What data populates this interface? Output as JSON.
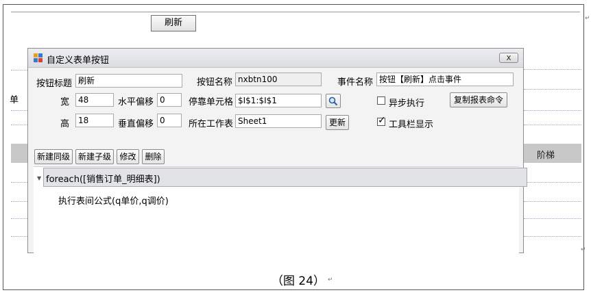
{
  "background": {
    "refresh_button_label": "刷新",
    "left_fragment": "单",
    "grid_header_label": "阶梯"
  },
  "dialog": {
    "title": "自定义表单按钮",
    "close_label": "x",
    "fields": {
      "button_title_label": "按钮标题",
      "button_title_value": "刷新",
      "button_name_label": "按钮名称",
      "button_name_value": "nxbtn100",
      "event_name_label": "事件名称",
      "event_name_value": "按钮【刷新】点击事件",
      "width_label": "宽",
      "width_value": "48",
      "h_offset_label": "水平偏移",
      "h_offset_value": "0",
      "dock_cell_label": "停靠单元格",
      "dock_cell_value": "$I$1:$I$1",
      "height_label": "高",
      "height_value": "18",
      "v_offset_label": "垂直偏移",
      "v_offset_value": "0",
      "sheet_label": "所在工作表",
      "sheet_value": "Sheet1"
    },
    "buttons": {
      "update": "更新",
      "copy_command": "复制报表命令",
      "new_sibling": "新建同级",
      "new_child": "新建子级",
      "modify": "修改",
      "delete": "删除"
    },
    "checkboxes": {
      "async_label": "异步执行",
      "async_checked": false,
      "toolbar_label": "工具栏显示",
      "toolbar_checked": true
    },
    "tree": {
      "root": "foreach([销售订单_明细表])",
      "child": "执行表间公式(q单价,q调价)"
    }
  },
  "caption": "（图 24）"
}
